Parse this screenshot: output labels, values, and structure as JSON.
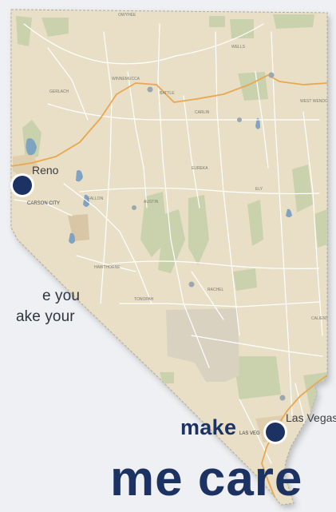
{
  "map": {
    "cities": {
      "reno": "Reno",
      "carson_city": "CARSON CITY",
      "las_vegas": "Las Vegas",
      "las_vegas_small": "LAS VEG"
    },
    "colors": {
      "land": "#e9e1c8",
      "park": "#c9d2ad",
      "desert": "#d9d2c0",
      "water": "#7fa3c3",
      "highway": "#e8a84f",
      "road": "#ffffff",
      "marker": "#1c3263",
      "border": "#a9a38f"
    }
  },
  "text": {
    "line1": "e you",
    "line2": "ake your",
    "heading_small": "make",
    "heading_large": "me care"
  }
}
